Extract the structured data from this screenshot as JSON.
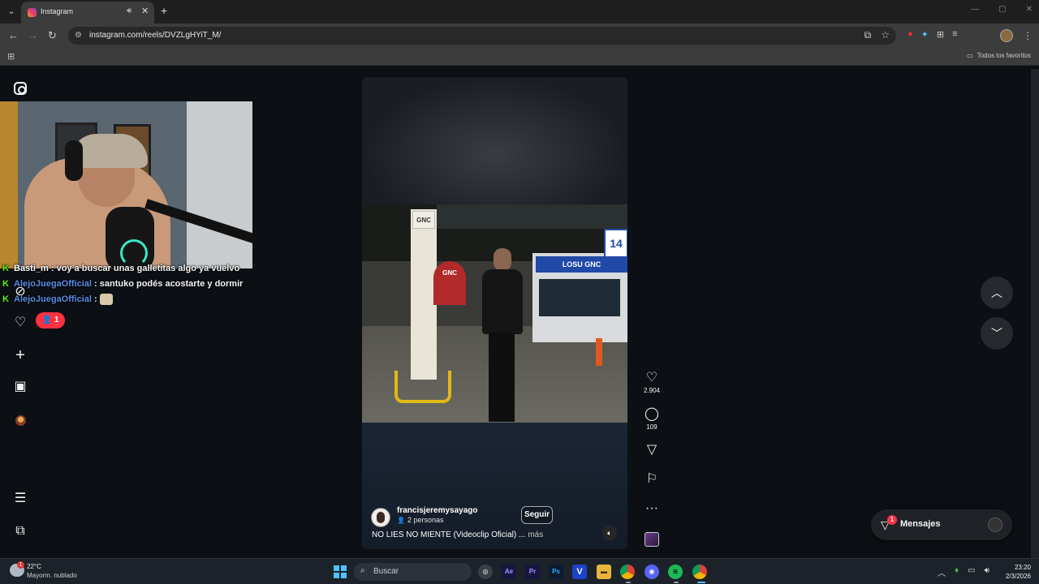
{
  "browser": {
    "tab_title": "Instagram",
    "url": "instagram.com/reels/DVZLgHYiT_M/",
    "bookmarks_folder": "Todos los favoritos"
  },
  "chat": {
    "messages": [
      {
        "user": "Basti_m",
        "text": ": voy a buscar unas galletitas algo ya vuelvo"
      },
      {
        "user": "AlejoJuegaOfficial",
        "text": ": santuko podés acostarte y dormir"
      },
      {
        "user": "AlejoJuegaOfficial",
        "text": ":"
      }
    ],
    "viewer_badge": "1"
  },
  "reel": {
    "video_text": {
      "gnc_sign": "GNC",
      "store_sign": "LOSU GNC",
      "pole_number": "14",
      "gnc_logo": "GNC"
    },
    "author": "francisjeremysayago",
    "author_sub": "2 personas",
    "follow_label": "Seguir",
    "caption": "NO LIES NO MIENTE (Videoclip Oficial) ...",
    "more_label": "más",
    "likes": "2.904",
    "comments": "109"
  },
  "messages": {
    "label": "Mensajes",
    "badge": "1"
  },
  "taskbar": {
    "temperature": "22°C",
    "weather": "Mayorm. nublado",
    "search_placeholder": "Buscar",
    "time": "23:20",
    "date": "2/3/2026",
    "apps": [
      "Ae",
      "Pr",
      "Ps",
      "V"
    ]
  },
  "colors": {
    "page_bg": "#0c1014",
    "chat_user": "#5b8ce6",
    "kick_green": "#53fc18",
    "notification_red": "#ff3040",
    "windows_blue": "#4cc2ff"
  }
}
